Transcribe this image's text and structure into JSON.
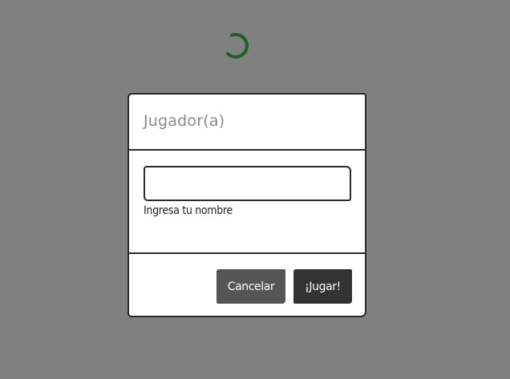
{
  "spinner": {
    "icon": "loading-spinner-icon",
    "color": "#1f5f2a"
  },
  "dialog": {
    "title": "Jugador(a)",
    "input": {
      "value": "",
      "placeholder": ""
    },
    "hint": "Ingresa tu nombre",
    "buttons": {
      "cancel_label": "Cancelar",
      "play_label": "¡Jugar!"
    }
  },
  "colors": {
    "overlay": "#808080",
    "cancel_button": "#555555",
    "play_button": "#333333"
  }
}
